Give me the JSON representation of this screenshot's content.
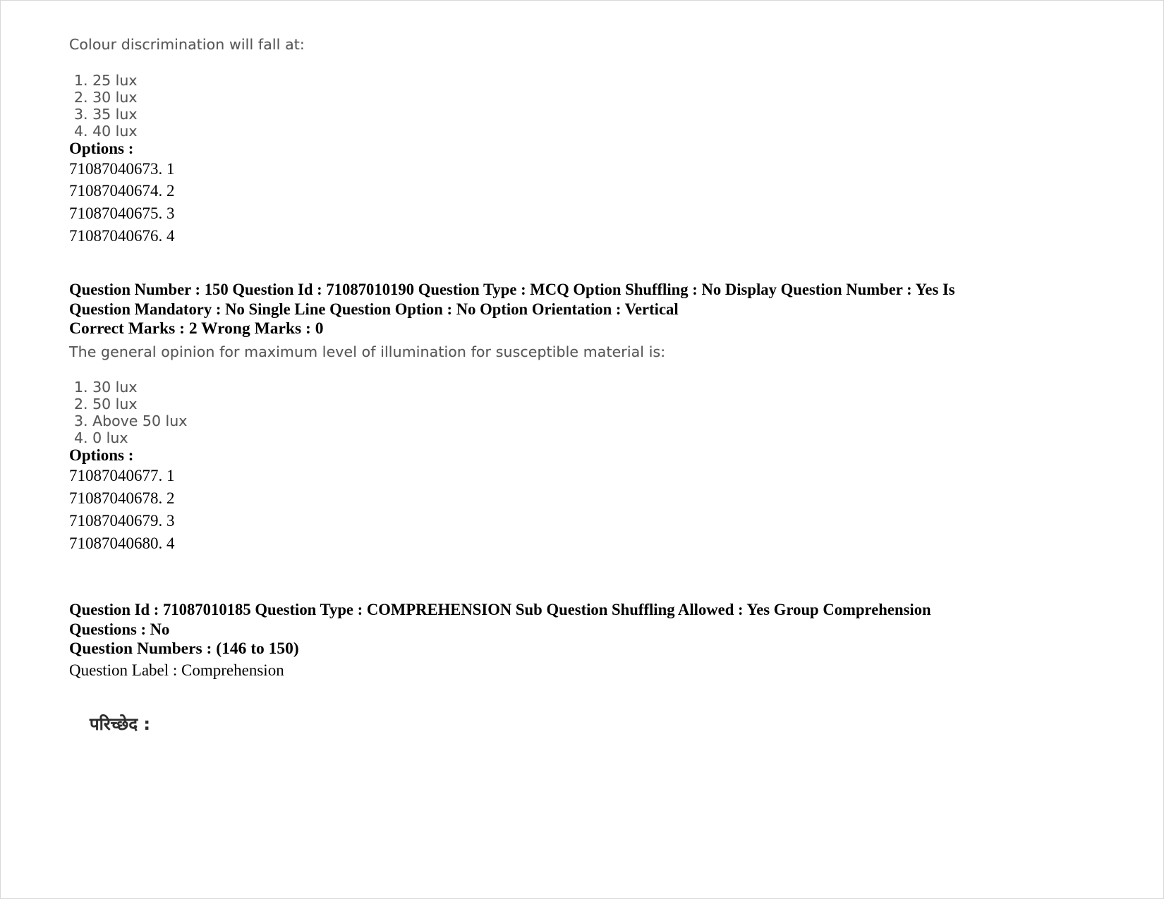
{
  "page": {
    "background": "#ffffff",
    "text_color": "#000000",
    "scan_text_color": "#4a4a4a"
  },
  "question_149": {
    "stem": "Colour discrimination will fall at:",
    "choices": [
      "1. 25 lux",
      "2. 30 lux",
      "3. 35 lux",
      "4. 40 lux"
    ],
    "options_label": "Options :",
    "option_ids": [
      "71087040673. 1",
      "71087040674. 2",
      "71087040675. 3",
      "71087040676. 4"
    ]
  },
  "question_150": {
    "header_line_1": "Question Number : 150 Question Id : 71087010190 Question Type : MCQ Option Shuffling : No Display Question Number : Yes Is Question Mandatory : No Single Line Question Option : No Option Orientation : Vertical",
    "header_line_2": "Correct Marks : 2 Wrong Marks : 0",
    "stem": "The general opinion for maximum level of illumination for susceptible material is:",
    "choices": [
      "1. 30 lux",
      "2. 50 lux",
      "3. Above 50 lux",
      "4. 0 lux"
    ],
    "options_label": "Options :",
    "option_ids": [
      "71087040677. 1",
      "71087040678. 2",
      "71087040679. 3",
      "71087040680. 4"
    ]
  },
  "comprehension_block": {
    "header_line_1": "Question Id : 71087010185 Question Type : COMPREHENSION Sub Question Shuffling Allowed : Yes Group Comprehension Questions : No",
    "header_line_2": "Question Numbers : (146 to 150)",
    "question_label": "Question Label : Comprehension",
    "passage_heading": "परिच्छेद :"
  }
}
